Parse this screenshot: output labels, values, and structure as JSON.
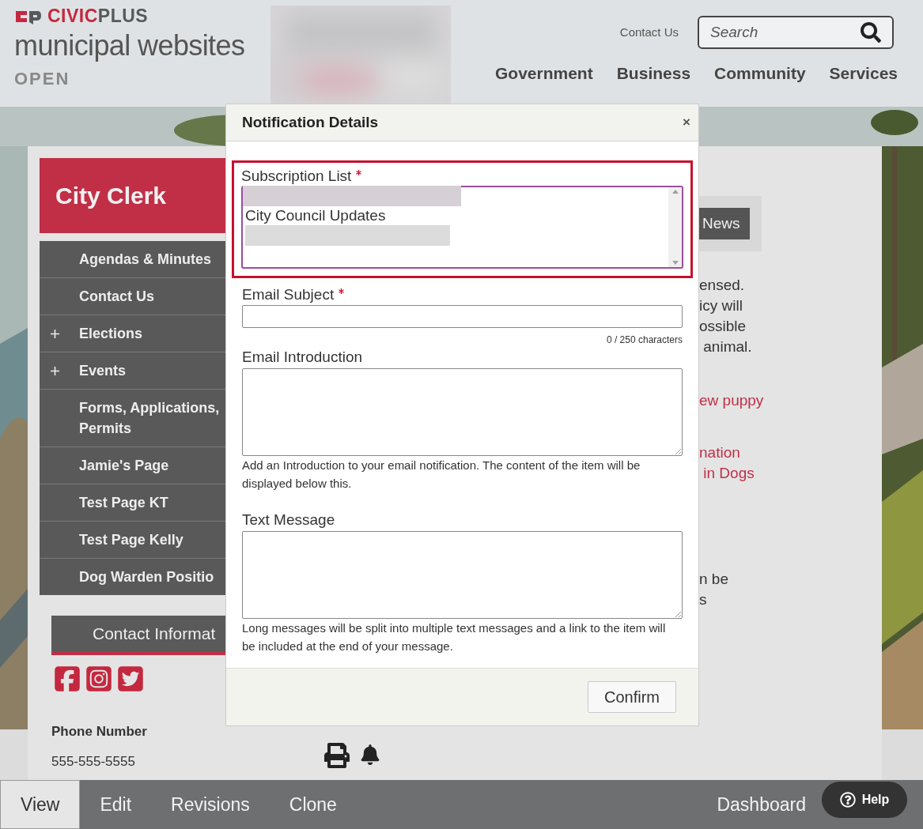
{
  "header": {
    "brand_primary": "CIVIC",
    "brand_secondary": "PLUS",
    "site_title": "municipal websites",
    "status": "OPEN",
    "top_link": "Contact Us",
    "search": {
      "placeholder": "Search"
    },
    "nav": [
      "Government",
      "Business",
      "Community",
      "Services"
    ]
  },
  "sidebar": {
    "title": "City Clerk",
    "items": [
      {
        "label": "Agendas & Minutes",
        "expandable": false
      },
      {
        "label": "Contact Us",
        "expandable": false
      },
      {
        "label": "Elections",
        "expandable": true
      },
      {
        "label": "Events",
        "expandable": true
      },
      {
        "label": "Forms, Applications, Permits",
        "expandable": false
      },
      {
        "label": "Jamie's Page",
        "expandable": false
      },
      {
        "label": "Test Page KT",
        "expandable": false
      },
      {
        "label": "Test Page Kelly",
        "expandable": false
      },
      {
        "label": "Dog Warden Positio",
        "expandable": false
      }
    ],
    "contact_heading": "Contact Informat",
    "phone_label": "Phone Number",
    "phone": "555-555-5555"
  },
  "content": {
    "tag_button": "News",
    "paragraphs": [
      {
        "kind": "text",
        "lines": [
          "ensed.",
          "icy will",
          "ossible",
          " animal."
        ]
      },
      {
        "kind": "link",
        "lines": [
          "ew puppy"
        ]
      },
      {
        "kind": "link",
        "lines": [
          "nation",
          " in Dogs"
        ]
      },
      {
        "kind": "text",
        "lines": [
          "n be",
          "s"
        ]
      }
    ]
  },
  "modal": {
    "title": "Notification Details",
    "close": "×",
    "fields": [
      {
        "kind": "listbox",
        "label": "Subscription List",
        "required": true,
        "highlighted": true,
        "options": [
          {
            "kind": "redacted"
          },
          {
            "kind": "text",
            "label": "City Council Updates"
          },
          {
            "kind": "redacted"
          }
        ]
      },
      {
        "kind": "input",
        "label": "Email Subject",
        "required": true,
        "counter": "0 / 250 characters"
      },
      {
        "kind": "textarea",
        "label": "Email Introduction",
        "required": false,
        "help": "Add an Introduction to your email notification. The content of the item will be displayed below this."
      },
      {
        "kind": "textarea",
        "label": "Text Message",
        "required": false,
        "help": "Long messages will be split into multiple text messages and a link to the item will be included at the end of your message."
      }
    ],
    "confirm": "Confirm"
  },
  "bottom_bar": {
    "tabs": [
      {
        "label": "View",
        "selected": true
      },
      {
        "label": "Edit",
        "selected": false
      },
      {
        "label": "Revisions",
        "selected": false
      },
      {
        "label": "Clone",
        "selected": false
      }
    ],
    "dashboard": "Dashboard",
    "help": "Help"
  }
}
